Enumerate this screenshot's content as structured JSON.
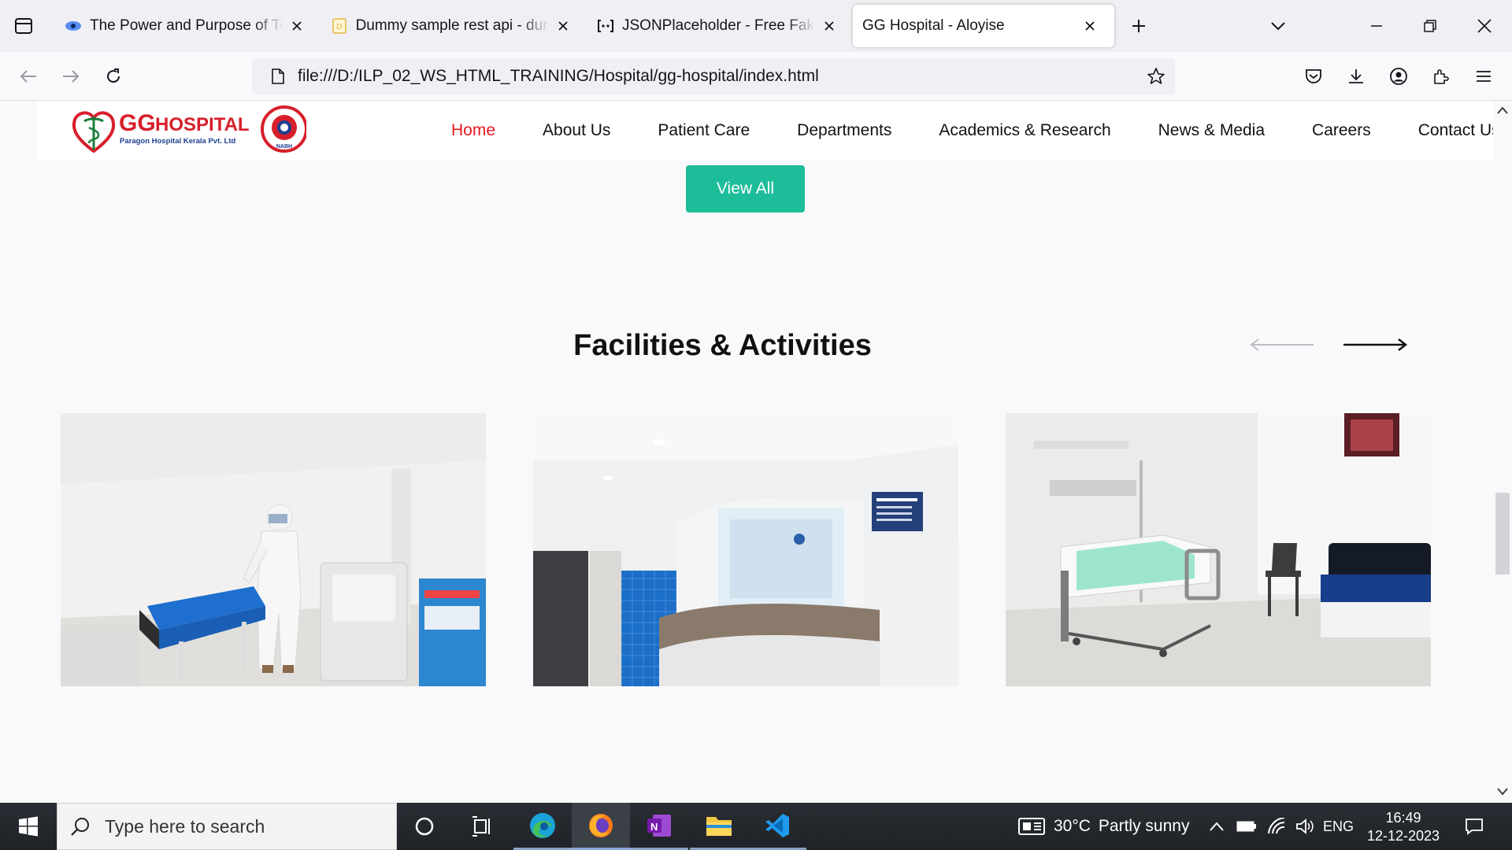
{
  "browser": {
    "tabs": [
      {
        "title": "The Power and Purpose of Team",
        "icon": "eye-icon"
      },
      {
        "title": "Dummy sample rest api - dummy",
        "icon": "document-icon"
      },
      {
        "title": "JSONPlaceholder - Free Fake REST",
        "icon": "placeholder-icon"
      },
      {
        "title": "GG Hospital - Aloyise",
        "icon": "none",
        "active": true
      }
    ],
    "url": "file:///D:/ILP_02_WS_HTML_TRAINING/Hospital/gg-hospital/index.html"
  },
  "site": {
    "logo": {
      "name": "GG HOSPITAL",
      "gg": "GG",
      "hospital": "HOSPITAL",
      "tagline": "Paragon Hospital Kerala Pvt. Ltd",
      "badge": "NABH"
    },
    "nav": [
      "Home",
      "About Us",
      "Patient Care",
      "Departments",
      "Academics & Research",
      "News & Media",
      "Careers",
      "Contact Us"
    ],
    "active_nav": "Home",
    "view_all_label": "View All",
    "section_title": "Facilities & Activities",
    "facility_images": [
      "lab-room-photo",
      "reception-desk-photo",
      "patient-room-photo"
    ]
  },
  "colors": {
    "accent": "#1dbd9a",
    "nav_active": "#e6191f",
    "logo_red": "#d71f2b",
    "logo_blue": "#1d3e8f"
  },
  "taskbar": {
    "search_placeholder": "Type here to search",
    "weather": {
      "temp": "30°C",
      "condition": "Partly sunny"
    },
    "language": "ENG",
    "time": "16:49",
    "date": "12-12-2023"
  }
}
